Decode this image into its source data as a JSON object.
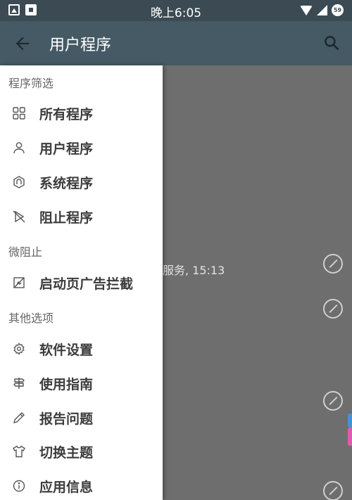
{
  "status_bar": {
    "time": "晚上6:05",
    "battery": "59"
  },
  "app_bar": {
    "title": "用户程序"
  },
  "background": {
    "visible_text": "服务, 15:13"
  },
  "drawer": {
    "sections": [
      {
        "title": "程序筛选",
        "items": [
          {
            "label": "所有程序",
            "icon": "grid-icon"
          },
          {
            "label": "用户程序",
            "icon": "person-icon"
          },
          {
            "label": "系统程序",
            "icon": "android-hexagon-icon"
          },
          {
            "label": "阻止程序",
            "icon": "blocked-play-icon"
          }
        ]
      },
      {
        "title": "微阻止",
        "items": [
          {
            "label": "启动页广告拦截",
            "icon": "ad-block-icon"
          }
        ]
      },
      {
        "title": "其他选项",
        "items": [
          {
            "label": "软件设置",
            "icon": "gear-icon"
          },
          {
            "label": "使用指南",
            "icon": "signpost-icon"
          },
          {
            "label": "报告问题",
            "icon": "pencil-icon"
          },
          {
            "label": "切换主题",
            "icon": "tshirt-icon"
          },
          {
            "label": "应用信息",
            "icon": "info-icon"
          }
        ]
      }
    ]
  },
  "colors": {
    "app_bar": "#455a64",
    "status_bar": "#3b4a53",
    "drawer_bg": "#ffffff",
    "accent_blue": "#4a8ed4",
    "accent_pink": "#e05bb0"
  }
}
